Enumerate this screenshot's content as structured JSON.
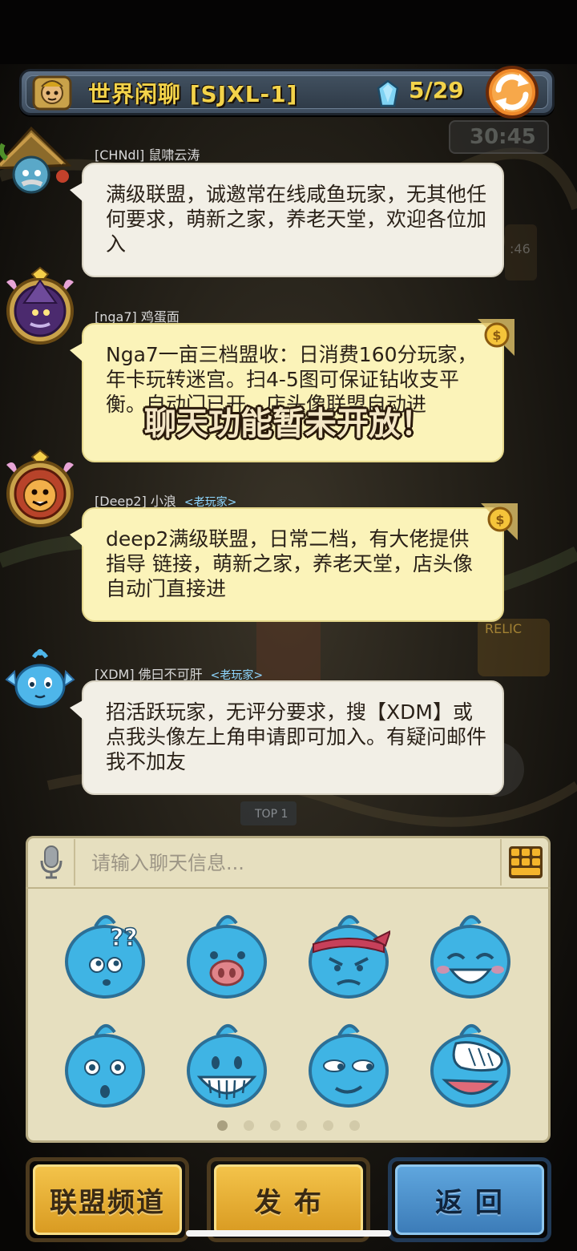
{
  "header": {
    "channel_title": "世界闲聊 [SJXL-1]",
    "count": "5/29",
    "timer": "30:45"
  },
  "messages": [
    {
      "sender": "[CHNdl] 鼠啸云涛",
      "tag": "",
      "text": "满级联盟，诚邀常在线咸鱼玩家，无其他任何要求，萌新之家，养老天堂，欢迎各位加入"
    },
    {
      "sender": "[nga7] 鸡蛋面",
      "tag": "",
      "text": "Nga7一亩三档盟收：日消费160分玩家，年卡玩转迷宫。扫4-5图可保证钻收支平衡。自动门已开。店头像联盟自动进"
    },
    {
      "sender": "[Deep2] 小浪",
      "tag": "<老玩家>",
      "text": "deep2满级联盟，日常二档，有大佬提供指导 链接，萌新之家，养老天堂，店头像自动门直接进"
    },
    {
      "sender": "[XDM] 佛曰不可肝",
      "tag": "<老玩家>",
      "text": "招活跃玩家，无评分要求，搜【XDM】或点我头像左上角申请即可加入。有疑问邮件我不加友"
    }
  ],
  "notice": "聊天功能暂未开放！",
  "input": {
    "placeholder": "请输入聊天信息..."
  },
  "emoji_names": [
    "confused",
    "pig-nose",
    "angry-headband",
    "laughing",
    "surprised",
    "grinning",
    "smug",
    "facepalm"
  ],
  "pagination": {
    "total": 6,
    "active": 0
  },
  "buttons": {
    "alliance": "联盟频道",
    "publish": "发 布",
    "back": "返 回"
  },
  "colors": {
    "title_gold": "#f3d34a",
    "bubble_white": "#f2efe6",
    "bubble_yellow": "#fbf3b9",
    "emoji_blue": "#3fb4e4"
  }
}
